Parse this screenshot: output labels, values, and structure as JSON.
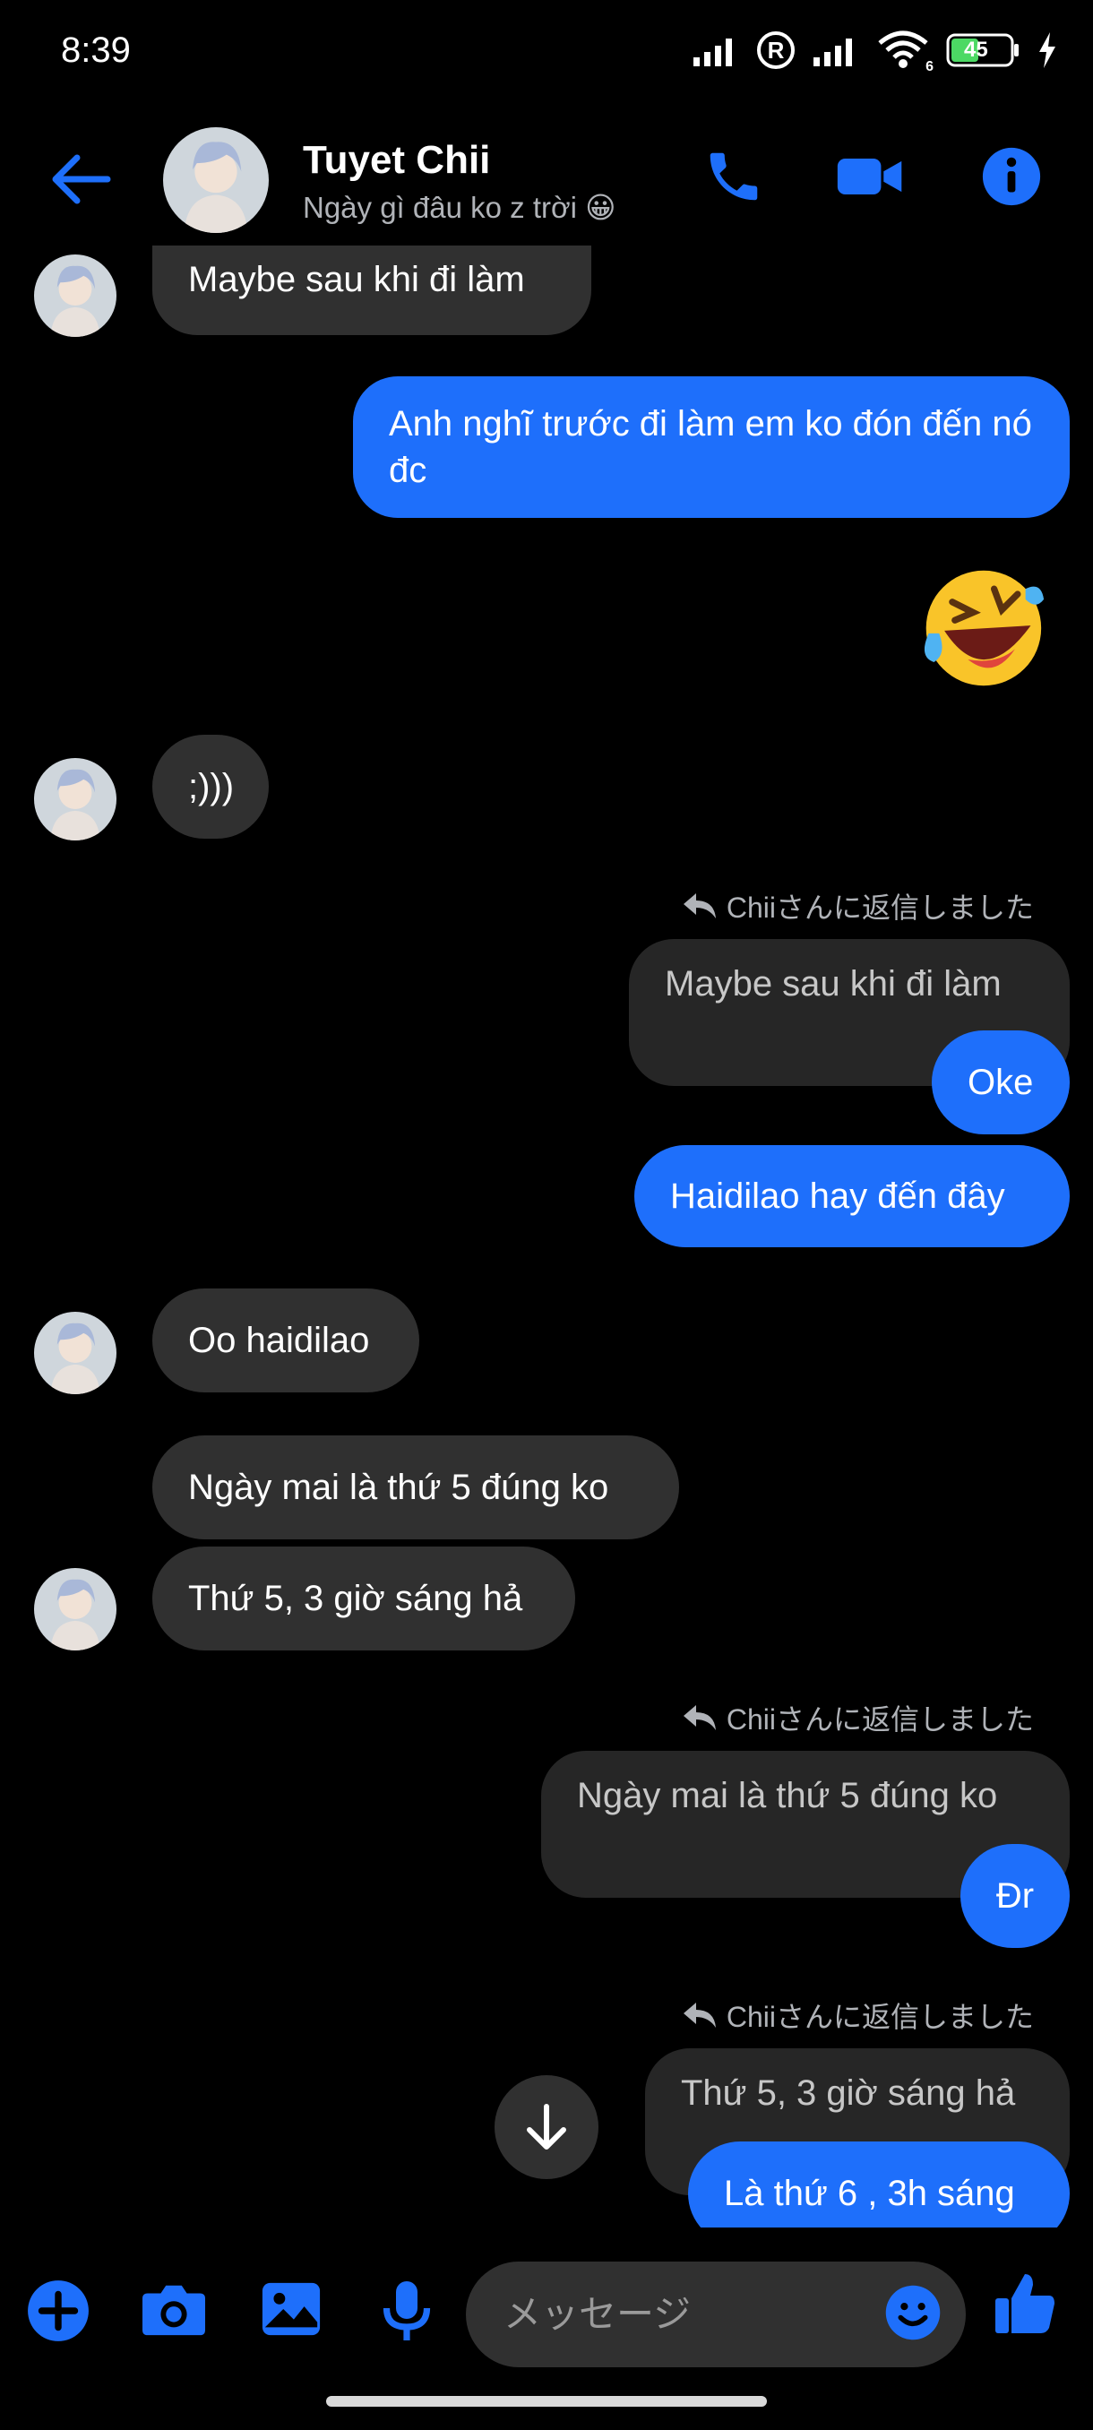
{
  "status": {
    "time": "8:39",
    "battery": "45",
    "wifi_label": "6"
  },
  "header": {
    "name": "Tuyet Chii",
    "status": "Ngày gì đâu ko z trời 😀"
  },
  "messages": {
    "m1": "Maybe sau khi đi làm",
    "m2": "Anh nghĩ trước đi làm em ko đón đến nó đc",
    "m3": ";)))",
    "reply_label_1": "Chiiさんに返信しました",
    "m4_quoted": "Maybe sau khi đi làm",
    "m4": "Oke",
    "m5": "Haidilao hay đến đây",
    "m6": "Oo haidilao",
    "m7": "Ngày mai là thứ 5 đúng ko",
    "m8": "Thứ 5, 3 giờ sáng hả",
    "reply_label_2": "Chiiさんに返信しました",
    "m9_quoted": "Ngày mai là thứ 5 đúng ko",
    "m9": "Đr",
    "reply_label_3": "Chiiさんに返信しました",
    "m10_quoted": "Thứ 5, 3 giờ sáng hả",
    "m10": "Là thứ 6 , 3h sáng"
  },
  "composer": {
    "placeholder": "メッセージ"
  },
  "colors": {
    "accent": "#1e6ffb",
    "bubble_in": "#303030",
    "background": "#000000"
  },
  "icons": [
    "back-arrow-icon",
    "phone-icon",
    "video-camera-icon",
    "info-icon",
    "plus-icon",
    "camera-icon",
    "image-icon",
    "microphone-icon",
    "emoji-icon",
    "thumbs-up-icon",
    "arrow-down-icon",
    "reply-icon"
  ]
}
